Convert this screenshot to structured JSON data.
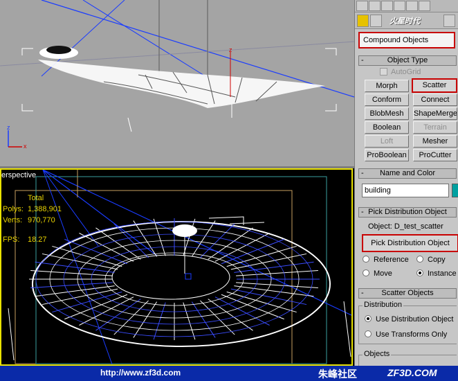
{
  "viewports": {
    "top": {
      "label": "",
      "axis_z": "z",
      "axis_x": "x"
    },
    "perspective": {
      "label": "erspective",
      "stats_header": "Total",
      "stats": [
        {
          "key": "Polys:",
          "value": "1,388,901"
        },
        {
          "key": "Verts:",
          "value": "970,770"
        },
        {
          "key": "FPS:",
          "value": "18.27"
        }
      ]
    }
  },
  "panel": {
    "logo": "火星时代",
    "category_dropdown": "Compound Objects",
    "object_type": {
      "title": "Object Type",
      "autogrid_label": "AutoGrid",
      "buttons": [
        {
          "label": "Morph",
          "enabled": true
        },
        {
          "label": "Scatter",
          "enabled": true
        },
        {
          "label": "Conform",
          "enabled": true
        },
        {
          "label": "Connect",
          "enabled": true
        },
        {
          "label": "BlobMesh",
          "enabled": true
        },
        {
          "label": "ShapeMerge",
          "enabled": true
        },
        {
          "label": "Boolean",
          "enabled": true
        },
        {
          "label": "Terrain",
          "enabled": false
        },
        {
          "label": "Loft",
          "enabled": false
        },
        {
          "label": "Mesher",
          "enabled": true
        },
        {
          "label": "ProBoolean",
          "enabled": true
        },
        {
          "label": "ProCutter",
          "enabled": true
        }
      ]
    },
    "name_and_color": {
      "title": "Name and Color",
      "name_value": "building",
      "color": "#00a0a0"
    },
    "pick_distribution": {
      "title": "Pick Distribution Object",
      "object_label": "Object: D_test_scatter",
      "pick_button": "Pick Distribution Object",
      "radios": [
        {
          "label": "Reference",
          "on": false
        },
        {
          "label": "Copy",
          "on": false
        },
        {
          "label": "Move",
          "on": false
        },
        {
          "label": "Instance",
          "on": true
        }
      ]
    },
    "scatter_objects": {
      "title": "Scatter Objects",
      "distribution_legend": "Distribution",
      "options": [
        {
          "label": "Use Distribution Object",
          "on": true
        },
        {
          "label": "Use Transforms Only",
          "on": false
        }
      ],
      "objects_legend": "Objects"
    },
    "rollout_mark": "-"
  },
  "footer": {
    "url": "http://www.zf3d.com",
    "brand_cn": "朱峰社区",
    "brand_en": "ZF3D.COM"
  }
}
